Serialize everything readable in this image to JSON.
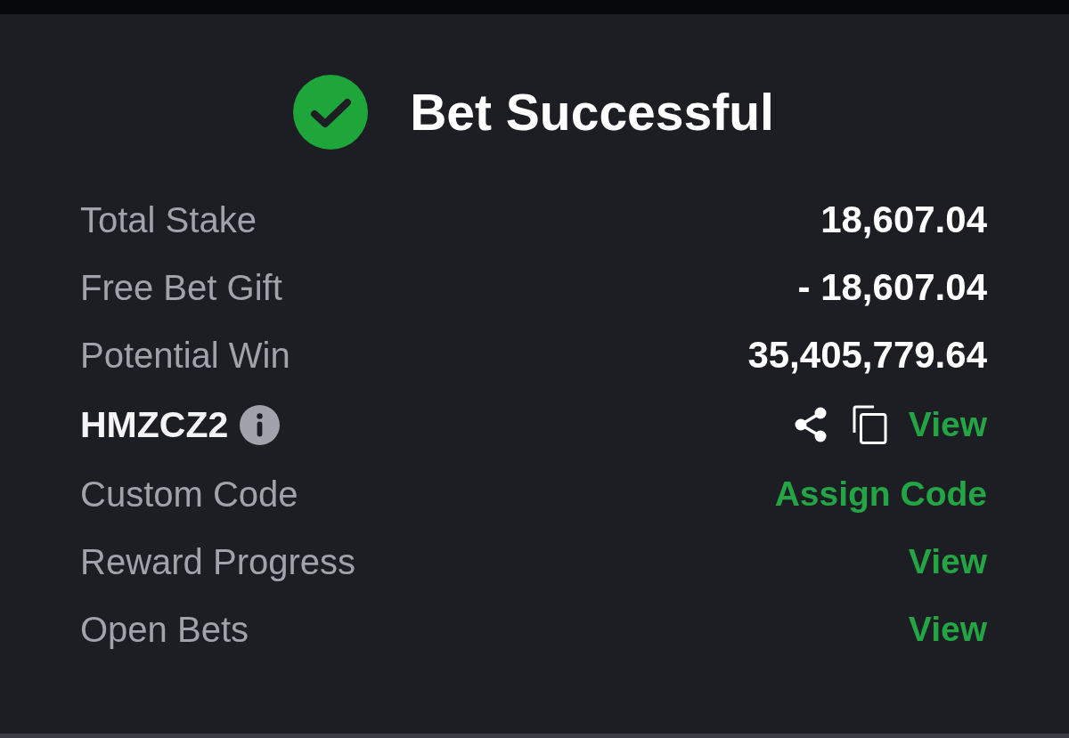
{
  "header": {
    "title": "Bet Successful"
  },
  "rows": [
    {
      "kind": "amount",
      "label": "Total Stake",
      "value": "18,607.04"
    },
    {
      "kind": "amount",
      "label": "Free Bet Gift",
      "value": "- 18,607.04"
    },
    {
      "kind": "amount",
      "label": "Potential Win",
      "value": "35,405,779.64"
    },
    {
      "kind": "code",
      "code": "HMZCZ2",
      "action": "View"
    },
    {
      "kind": "link",
      "label": "Custom Code",
      "action": "Assign Code"
    },
    {
      "kind": "link",
      "label": "Reward Progress",
      "action": "View"
    },
    {
      "kind": "link",
      "label": "Open Bets",
      "action": "View"
    }
  ]
}
